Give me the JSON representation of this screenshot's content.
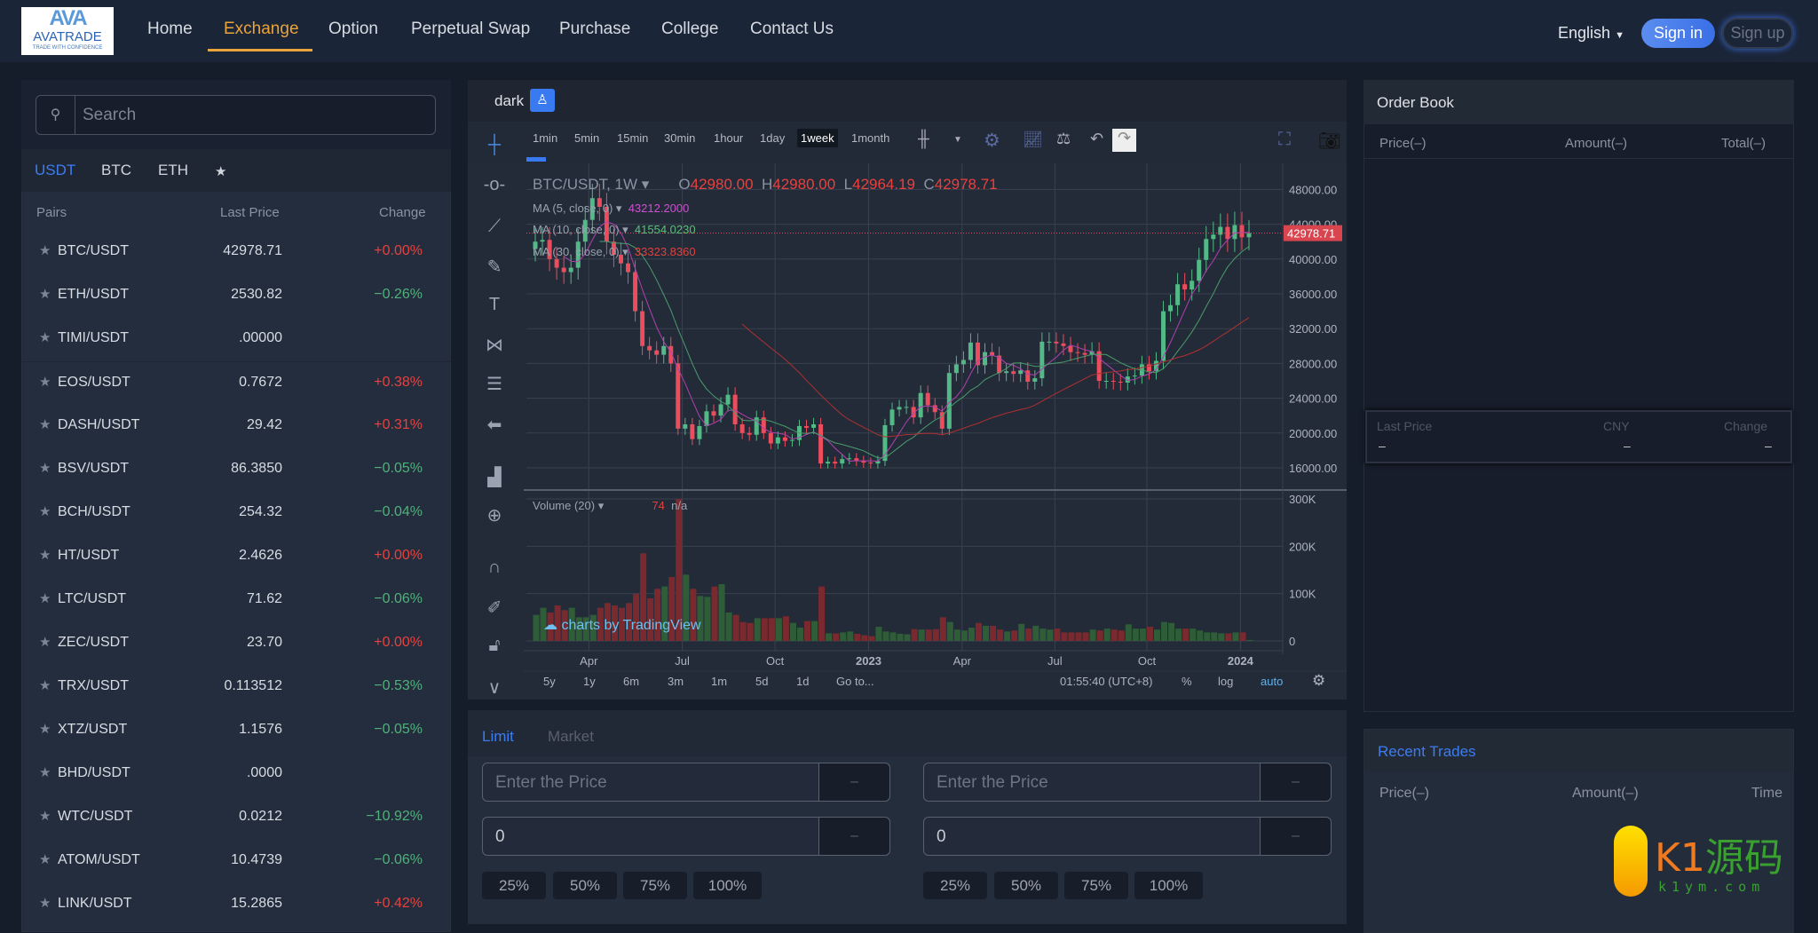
{
  "header": {
    "logo": {
      "mark": "AVA",
      "name": "AVATRADE",
      "tagline": "TRADE WITH CONFIDENCE"
    },
    "nav": [
      "Home",
      "Exchange",
      "Option",
      "Perpetual Swap",
      "Purchase",
      "College",
      "Contact Us"
    ],
    "active_nav": "Exchange",
    "language": "English",
    "sign_in": "Sign in",
    "sign_up": "Sign up"
  },
  "markets": {
    "search_placeholder": "Search",
    "tabs": [
      "USDT",
      "BTC",
      "ETH",
      "★"
    ],
    "columns": [
      "Pairs",
      "Last Price",
      "Change"
    ],
    "rows": [
      {
        "pair": "BTC/USDT",
        "price": "42978.71",
        "change": "+0.00%",
        "dir": "up"
      },
      {
        "pair": "ETH/USDT",
        "price": "2530.82",
        "change": "−0.26%",
        "dir": "down"
      },
      {
        "pair": "TIMI/USDT",
        "price": ".00000",
        "change": "",
        "dir": ""
      },
      {
        "pair": "EOS/USDT",
        "price": "0.7672",
        "change": "+0.38%",
        "dir": "up"
      },
      {
        "pair": "DASH/USDT",
        "price": "29.42",
        "change": "+0.31%",
        "dir": "up"
      },
      {
        "pair": "BSV/USDT",
        "price": "86.3850",
        "change": "−0.05%",
        "dir": "down"
      },
      {
        "pair": "BCH/USDT",
        "price": "254.32",
        "change": "−0.04%",
        "dir": "down"
      },
      {
        "pair": "HT/USDT",
        "price": "2.4626",
        "change": "+0.00%",
        "dir": "up"
      },
      {
        "pair": "LTC/USDT",
        "price": "71.62",
        "change": "−0.06%",
        "dir": "down"
      },
      {
        "pair": "ZEC/USDT",
        "price": "23.70",
        "change": "+0.00%",
        "dir": "up"
      },
      {
        "pair": "TRX/USDT",
        "price": "0.113512",
        "change": "−0.53%",
        "dir": "down"
      },
      {
        "pair": "XTZ/USDT",
        "price": "1.1576",
        "change": "−0.05%",
        "dir": "down"
      },
      {
        "pair": "BHD/USDT",
        "price": ".0000",
        "change": "",
        "dir": ""
      },
      {
        "pair": "WTC/USDT",
        "price": "0.0212",
        "change": "−10.92%",
        "dir": "down"
      },
      {
        "pair": "ATOM/USDT",
        "price": "10.4739",
        "change": "−0.06%",
        "dir": "down"
      },
      {
        "pair": "LINK/USDT",
        "price": "15.2865",
        "change": "+0.42%",
        "dir": "up"
      }
    ]
  },
  "chart": {
    "theme_label": "dark",
    "intervals": [
      "1min",
      "5min",
      "15min",
      "30min",
      "1hour",
      "1day",
      "1week",
      "1month"
    ],
    "active_interval": "1week",
    "symbol": "BTC/USDT, 1W",
    "ohlc": {
      "o_label": "O",
      "o": "42980.00",
      "h_label": "H",
      "h": "42980.00",
      "l_label": "L",
      "l": "42964.19",
      "c_label": "C",
      "c": "42978.71"
    },
    "ma": [
      {
        "label": "MA (5, close, 0)",
        "value": "43212.2000",
        "color": "#d04fd0"
      },
      {
        "label": "MA (10, close, 0)",
        "value": "41554.0230",
        "color": "#5fbf7a"
      },
      {
        "label": "MA (30, close, 0)",
        "value": "33323.8360",
        "color": "#e0413a"
      }
    ],
    "volume_label": "Volume (20)",
    "volume_value": "74",
    "volume_ma": "n/a",
    "last_price_tag": "42978.71",
    "watermark": "charts by TradingView",
    "ranges": [
      "5y",
      "1y",
      "6m",
      "3m",
      "1m",
      "5d",
      "1d",
      "Go to..."
    ],
    "clock": "01:55:40 (UTC+8)",
    "scale_opts": [
      "%",
      "log",
      "auto"
    ]
  },
  "chart_data": {
    "type": "candlestick",
    "interval": "1W",
    "start": "2022-02 (week 1)",
    "closes": [
      42000,
      42200,
      40000,
      39000,
      38500,
      39000,
      42000,
      44500,
      47000,
      46000,
      42000,
      40500,
      39500,
      38500,
      34000,
      30000,
      29500,
      29000,
      30000,
      28000,
      20500,
      21000,
      19300,
      20800,
      22500,
      22000,
      23300,
      24400,
      21000,
      20000,
      19800,
      21800,
      20000,
      18800,
      19500,
      19100,
      19200,
      20800,
      20600,
      21000,
      16500,
      16700,
      16500,
      17000,
      17100,
      16800,
      16600,
      16500,
      16800,
      20900,
      22700,
      23000,
      23000,
      21800,
      24600,
      23200,
      22400,
      20500,
      26900,
      27900,
      28400,
      30400,
      27800,
      29300,
      28900,
      26900,
      27100,
      26800,
      27200,
      25900,
      26300,
      30500,
      30500,
      30300,
      30000,
      29300,
      29200,
      29000,
      29400,
      26000,
      26000,
      25900,
      25800,
      26500,
      26600,
      27900,
      27100,
      28300,
      34000,
      34700,
      37100,
      36500,
      37500,
      39900,
      42300,
      42800,
      43700,
      42300,
      43900,
      42500,
      42978.71
    ],
    "volumes_k": [
      55,
      70,
      60,
      75,
      65,
      70,
      50,
      50,
      55,
      70,
      80,
      75,
      70,
      80,
      100,
      185,
      90,
      110,
      115,
      135,
      300,
      140,
      110,
      95,
      93,
      115,
      120,
      60,
      55,
      40,
      38,
      48,
      48,
      48,
      48,
      52,
      38,
      28,
      42,
      42,
      115,
      16,
      16,
      18,
      20,
      15,
      12,
      10,
      30,
      20,
      18,
      15,
      14,
      25,
      24,
      24,
      25,
      50,
      40,
      24,
      22,
      28,
      38,
      32,
      32,
      24,
      20,
      22,
      36,
      26,
      32,
      26,
      24,
      26,
      18,
      18,
      18,
      18,
      24,
      22,
      26,
      24,
      22,
      35,
      26,
      26,
      30,
      24,
      40,
      38,
      26,
      26,
      26,
      22,
      18,
      18,
      16,
      16,
      18,
      18,
      2
    ],
    "price_axis": [
      "48000.00",
      "44000.00",
      "40000.00",
      "36000.00",
      "32000.00",
      "28000.00",
      "24000.00",
      "20000.00",
      "16000.00"
    ],
    "price_range": [
      16000,
      48000
    ],
    "volume_axis": [
      "300K",
      "200K",
      "100K",
      "0"
    ],
    "volume_range": [
      0,
      300
    ],
    "time_ticks": [
      {
        "label": "Apr",
        "week": 7.5,
        "bold": false
      },
      {
        "label": "Jul",
        "week": 20.6,
        "bold": false
      },
      {
        "label": "Oct",
        "week": 33.6,
        "bold": false
      },
      {
        "label": "2023",
        "week": 46.7,
        "bold": true
      },
      {
        "label": "Apr",
        "week": 59.8,
        "bold": false
      },
      {
        "label": "Jul",
        "week": 72.8,
        "bold": false
      },
      {
        "label": "Oct",
        "week": 85.7,
        "bold": false
      },
      {
        "label": "2024",
        "week": 98.8,
        "bold": true
      }
    ]
  },
  "order_form": {
    "tabs": [
      "Limit",
      "Market"
    ],
    "active_tab": "Limit",
    "price_placeholder": "Enter the Price",
    "amount_value": "0",
    "unit": "–",
    "percents": [
      "25%",
      "50%",
      "75%",
      "100%"
    ]
  },
  "order_book": {
    "title": "Order Book",
    "columns": [
      "Price(–)",
      "Amount(–)",
      "Total(–)"
    ],
    "summary_labels": [
      "Last Price",
      "CNY",
      "Change"
    ],
    "summary_values": [
      "–",
      "–",
      "–"
    ]
  },
  "recent_trades": {
    "title": "Recent Trades",
    "columns": [
      "Price(–)",
      "Amount(–)",
      "Time"
    ]
  },
  "watermark_logo": {
    "text": "K1源码",
    "url_text": "k1ym.com"
  },
  "colors": {
    "accent": "#3d7cf0",
    "nav_active": "#e9a43a",
    "up": "#e8413e",
    "down": "#4fb27a"
  }
}
